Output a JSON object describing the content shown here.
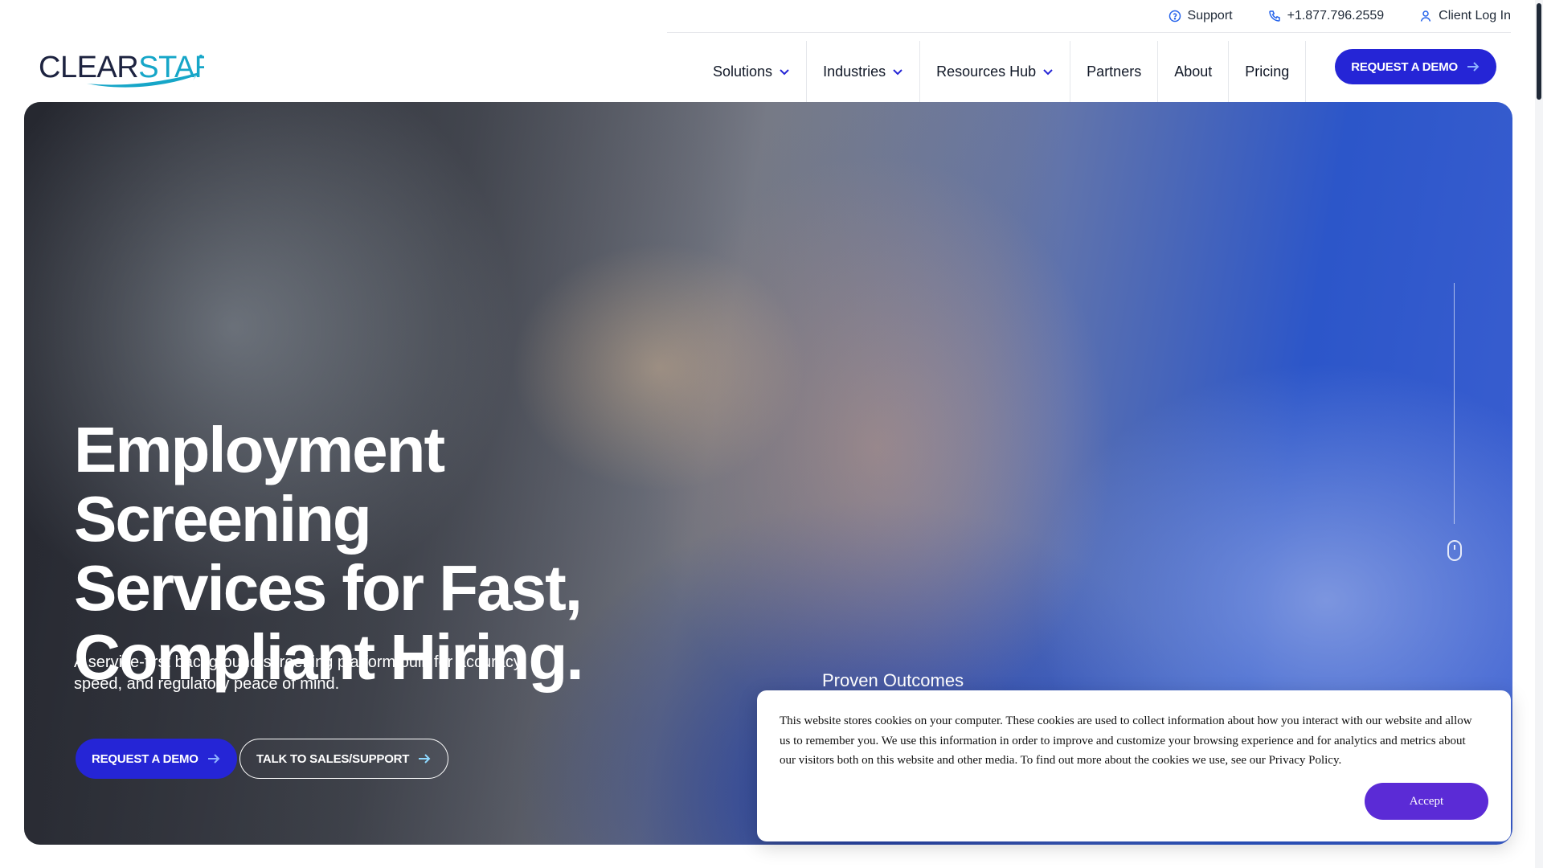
{
  "utility_bar": {
    "support": "Support",
    "phone": "+1.877.796.2559",
    "client_login": "Client Log In"
  },
  "logo": {
    "part1": "CLEAR",
    "part2": "STAR",
    "colors": {
      "dark": "#1d2340",
      "accent": "#16a6c8"
    }
  },
  "nav": {
    "items": [
      {
        "label": "Solutions",
        "has_dropdown": true
      },
      {
        "label": "Industries",
        "has_dropdown": true
      },
      {
        "label": "Resources Hub",
        "has_dropdown": true
      },
      {
        "label": "Partners",
        "has_dropdown": false
      },
      {
        "label": "About",
        "has_dropdown": false
      },
      {
        "label": "Pricing",
        "has_dropdown": false
      }
    ],
    "demo_button": "REQUEST A DEMO"
  },
  "hero": {
    "title_line1": "Employment Screening",
    "title_line2": "Services for Fast,",
    "title_line3": "Compliant Hiring.",
    "subtitle": "A service-first background screening platform built for accuracy, speed, and regulatory peace of mind.",
    "primary_button": "REQUEST A DEMO",
    "secondary_button": "TALK TO SALES/SUPPORT",
    "proven_outcomes": "Proven Outcomes"
  },
  "cookie_banner": {
    "text": "This website stores cookies on your computer. These cookies are used to collect information about how you interact with our website and allow us to remember you. We use this information in order to improve and customize your browsing experience and for analytics and metrics about our visitors both on this website and other media. To find out more about the cookies we use, see our ",
    "link_text": "Privacy Policy",
    "accept_label": "Accept"
  },
  "colors": {
    "brand_blue": "#2525d6",
    "accept_purple": "#5b2bd6",
    "icon_blue": "#2563eb"
  }
}
